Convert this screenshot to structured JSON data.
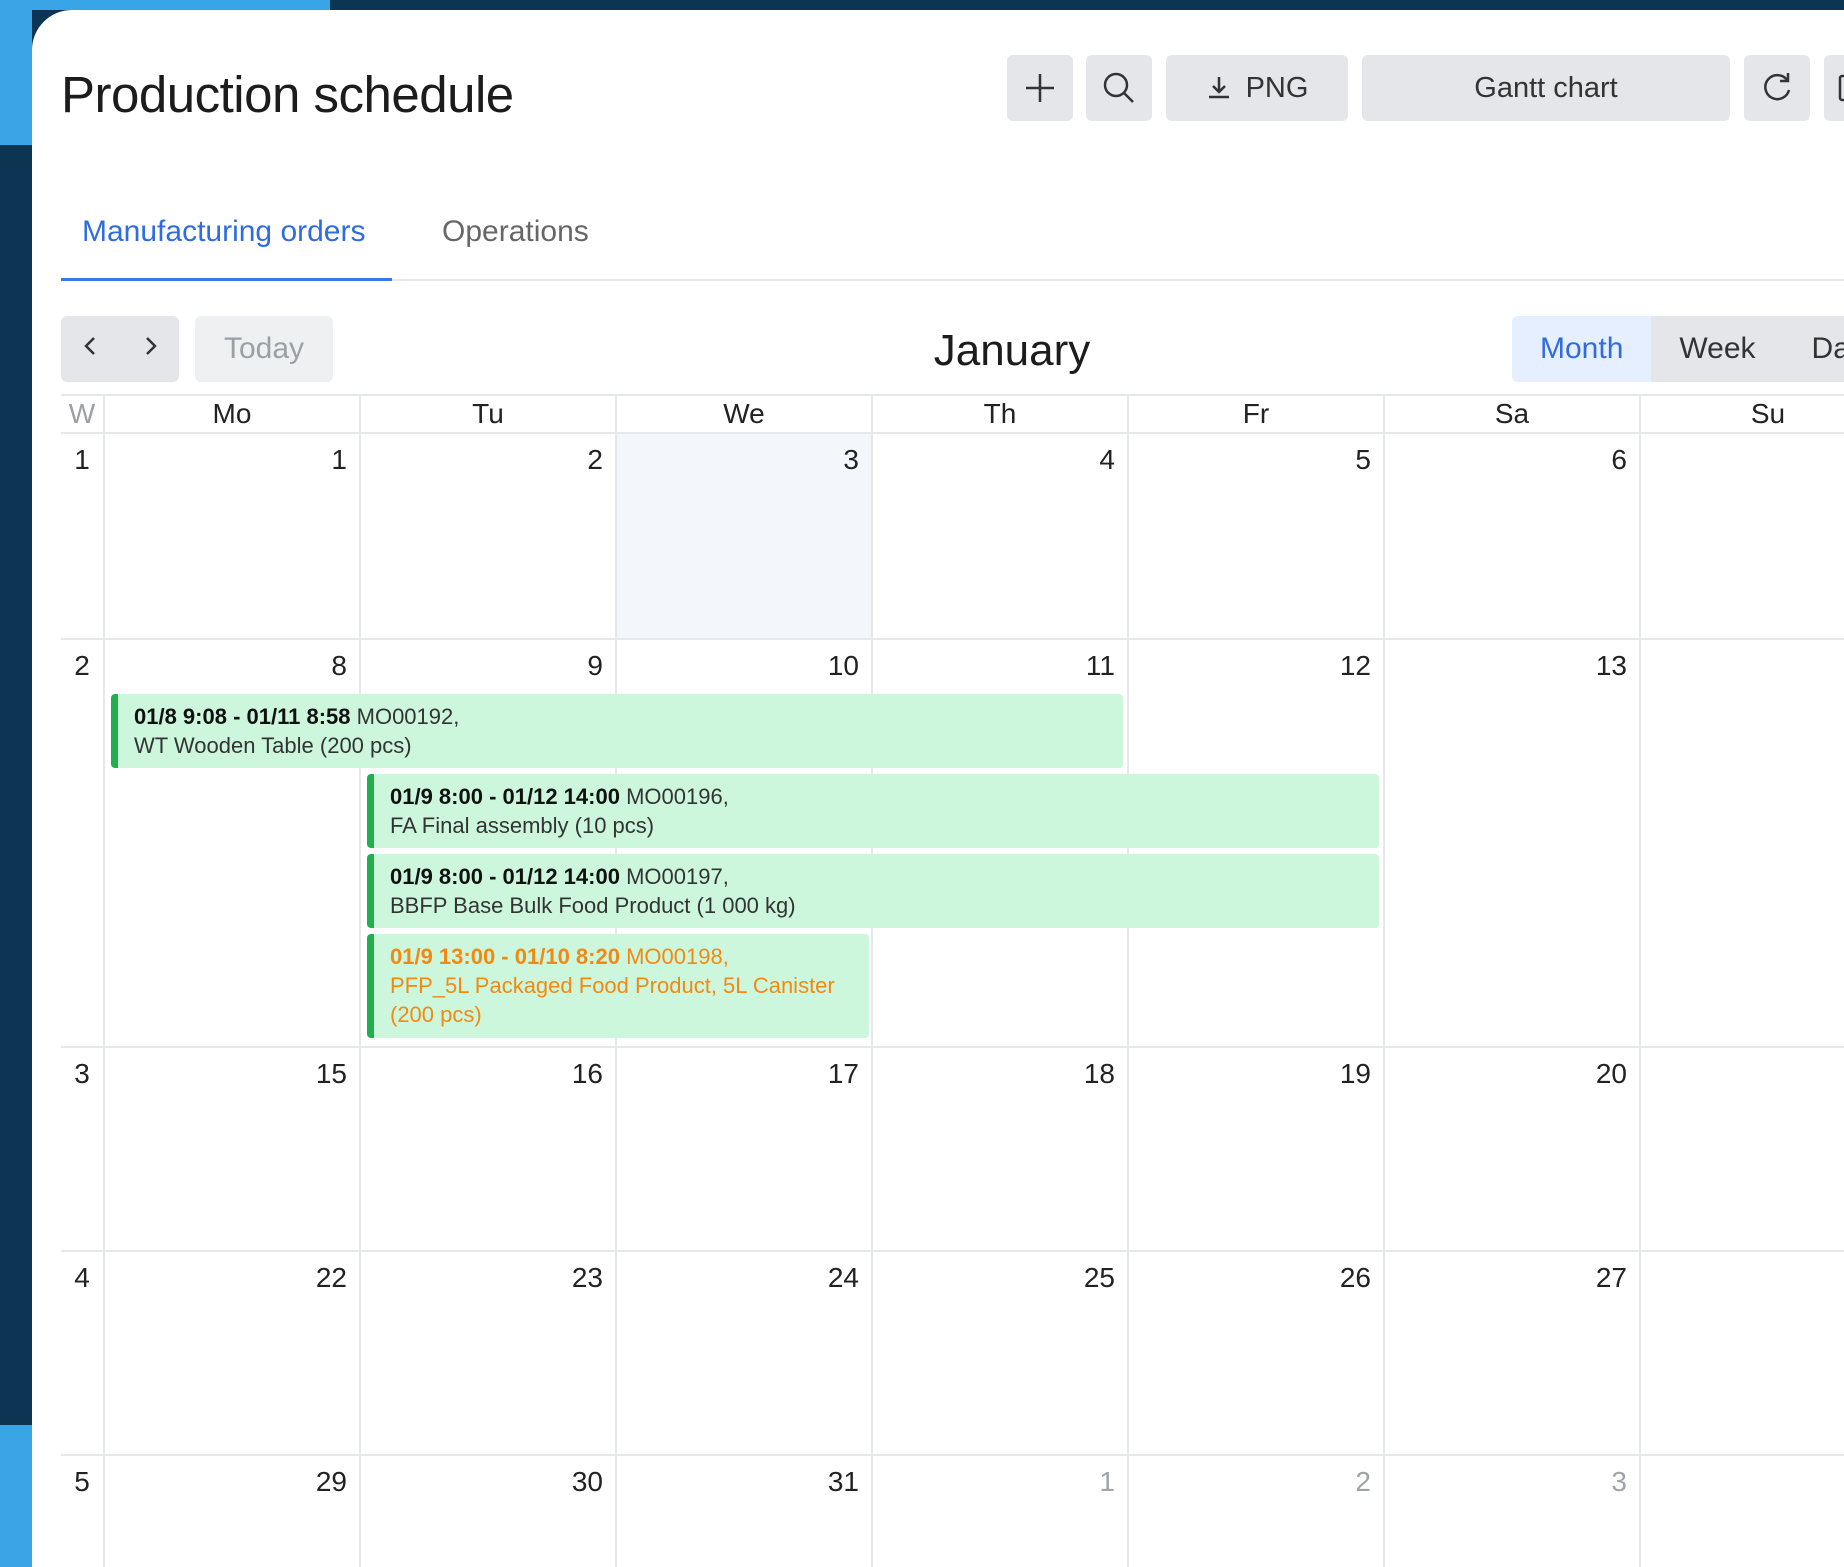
{
  "page": {
    "title": "Production schedule"
  },
  "toolbar": {
    "png_label": "PNG",
    "gantt_label": "Gantt chart"
  },
  "tabs": [
    {
      "label": "Manufacturing orders"
    },
    {
      "label": "Operations"
    }
  ],
  "calendar_nav": {
    "today_label": "Today",
    "month_title": "January",
    "views": [
      {
        "label": "Month"
      },
      {
        "label": "Week"
      },
      {
        "label": "Da"
      }
    ]
  },
  "calendar": {
    "week_header": "W",
    "day_headers": [
      "Mo",
      "Tu",
      "We",
      "Th",
      "Fr",
      "Sa",
      "Su"
    ],
    "weeks": [
      {
        "week": "1",
        "days": [
          "1",
          "2",
          "3",
          "4",
          "5",
          "6",
          ""
        ]
      },
      {
        "week": "2",
        "days": [
          "8",
          "9",
          "10",
          "11",
          "12",
          "13",
          ""
        ]
      },
      {
        "week": "3",
        "days": [
          "15",
          "16",
          "17",
          "18",
          "19",
          "20",
          ""
        ]
      },
      {
        "week": "4",
        "days": [
          "22",
          "23",
          "24",
          "25",
          "26",
          "27",
          ""
        ]
      },
      {
        "week": "5",
        "days": [
          "29",
          "30",
          "31",
          "1",
          "2",
          "3",
          ""
        ]
      }
    ]
  },
  "events": [
    {
      "time": "01/8 9:08 - 01/11 8:58",
      "code": "MO00192,",
      "desc": "WT Wooden Table (200 pcs)",
      "status": "ok"
    },
    {
      "time": "01/9 8:00 - 01/12 14:00",
      "code": "MO00196,",
      "desc": "FA Final assembly (10 pcs)",
      "status": "ok"
    },
    {
      "time": "01/9 8:00 - 01/12 14:00",
      "code": "MO00197,",
      "desc": "BBFP Base Bulk Food Product (1 000 kg)",
      "status": "ok"
    },
    {
      "time": "01/9 13:00 - 01/10 8:20",
      "code": "MO00198,",
      "desc": "PFP_5L Packaged Food Product, 5L Canister (200 pcs)",
      "status": "warning"
    }
  ],
  "colors": {
    "accent": "#2f6ce0",
    "event_bg": "#cdf7dd",
    "event_border": "#22b04f",
    "warning_text": "#f28a12"
  }
}
